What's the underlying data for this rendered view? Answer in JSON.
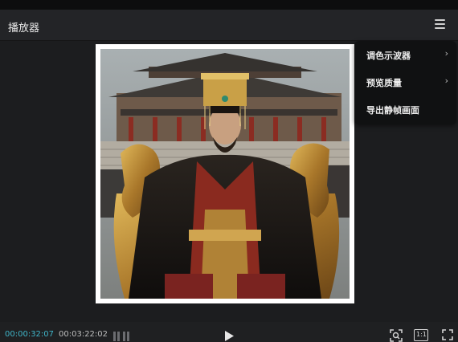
{
  "window": {
    "title": "播放器"
  },
  "menu": {
    "items": [
      {
        "label": "调色示波器",
        "has_submenu": true,
        "arrow": "›"
      },
      {
        "label": "预览质量",
        "has_submenu": true,
        "arrow": "›"
      },
      {
        "label": "导出静帧画面",
        "has_submenu": false,
        "arrow": ""
      }
    ]
  },
  "player": {
    "current_time": "00:00:32:07",
    "total_time": "00:03:22:02",
    "ratio_label": "1:1"
  },
  "colors": {
    "accent": "#3fb4c8",
    "background": "#1f2022",
    "menu_bg": "#101112"
  }
}
